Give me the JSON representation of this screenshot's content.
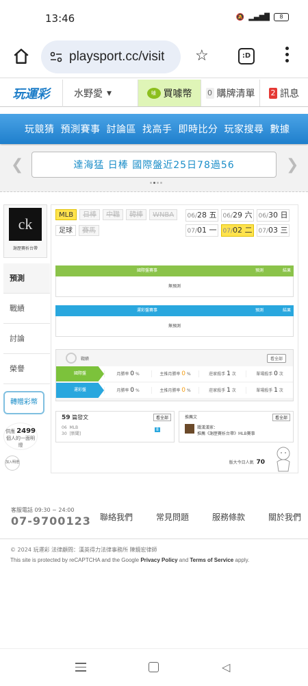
{
  "status": {
    "time": "13:46",
    "battery": "8"
  },
  "browser": {
    "url": "playsport.cc/visit",
    "tab_label": ":D"
  },
  "site": {
    "logo": "玩運彩",
    "username": "水野愛",
    "buy_coins": "買噱幣",
    "coin_icon": "噱",
    "cart_label": "購牌清單",
    "cart_count": "0",
    "messages_label": "訊息",
    "messages_count": "2"
  },
  "nav": [
    "玩競猜",
    "預測賽事",
    "討論區",
    "找高手",
    "即時比分",
    "玩家搜尋",
    "數據"
  ],
  "marquee": {
    "text": "達海猛 日棒 國際盤近25日78過56"
  },
  "profile": {
    "avatar_text": "ck",
    "name": "謝歷賽析台帶",
    "tabs": [
      "預測",
      "戰績",
      "討論",
      "榮譽"
    ],
    "buy_button": "轉贈彩幣",
    "followers_label": "供應",
    "followers_count": "2499",
    "followers_suffix": "個人的一面明燈",
    "add_label": "加入明燈"
  },
  "leagues": [
    {
      "label": "MLB",
      "state": "sel"
    },
    {
      "label": "日棒",
      "state": "off"
    },
    {
      "label": "中職",
      "state": "off"
    },
    {
      "label": "韓棒",
      "state": "off"
    },
    {
      "label": "WNBA",
      "state": "off"
    },
    {
      "label": "足球",
      "state": "on"
    },
    {
      "label": "賽馬",
      "state": "off"
    }
  ],
  "dates": [
    {
      "d": "06/",
      "n": "28 五"
    },
    {
      "d": "06/",
      "n": "29 六"
    },
    {
      "d": "06/",
      "n": "30 日"
    },
    {
      "d": "07/",
      "n": "01 一"
    },
    {
      "d": "07/",
      "n": "02 二",
      "sel": true
    },
    {
      "d": "07/",
      "n": "03 三"
    }
  ],
  "table1": {
    "h1": "國際盤賽事",
    "h2": "預測",
    "h3": "結果",
    "empty": "無預測"
  },
  "table2": {
    "h1": "運彩盤賽事",
    "h2": "預測",
    "h3": "結果",
    "empty": "無預測"
  },
  "stats": {
    "title": "戰績",
    "view_all": "看全部",
    "rows": [
      {
        "tag": "國際盤",
        "c1": "月勝率",
        "v1": "0",
        "u1": "%",
        "c2": "主推月勝率",
        "v2": "0",
        "u2": "%",
        "c3": "莊家殺手",
        "v3": "1",
        "u3": "次",
        "c4": "單場殺手",
        "v4": "0",
        "u4": "次"
      },
      {
        "tag": "運彩盤",
        "c1": "月勝率",
        "v1": "0",
        "u1": "%",
        "c2": "主推月勝率",
        "v2": "0",
        "u2": "%",
        "c3": "莊家殺手",
        "v3": "1",
        "u3": "次",
        "c4": "單場殺手",
        "v4": "1",
        "u4": "次"
      }
    ]
  },
  "posts": {
    "count": "59",
    "label": "篇發文",
    "view_all": "看全部",
    "date1": "06",
    "date2": "30",
    "league": "MLB",
    "title": "[新聞]",
    "badge": "8"
  },
  "recs": {
    "title": "推薦文",
    "view_all": "看全部",
    "author": "鐵漢漢家：",
    "text": "推薦《謝歷賽析台帶》MLB賽事"
  },
  "popular": {
    "label": "版大今日人氣",
    "value": "70"
  },
  "footer": {
    "phone_label": "客服電話 09:30 ~ 24:00",
    "phone": "07-9700123",
    "links": [
      "聯絡我們",
      "常見問題",
      "服務條款",
      "關於我們"
    ],
    "copyright": "© 2024 玩運彩 法律顧問：漢英得力法律事務所 陳鏡宏律師",
    "recaptcha_pre": "This site is protected by reCAPTCHA and the Google ",
    "privacy": "Privacy Policy",
    "and": " and ",
    "terms": "Terms of Service",
    "apply": " apply."
  }
}
